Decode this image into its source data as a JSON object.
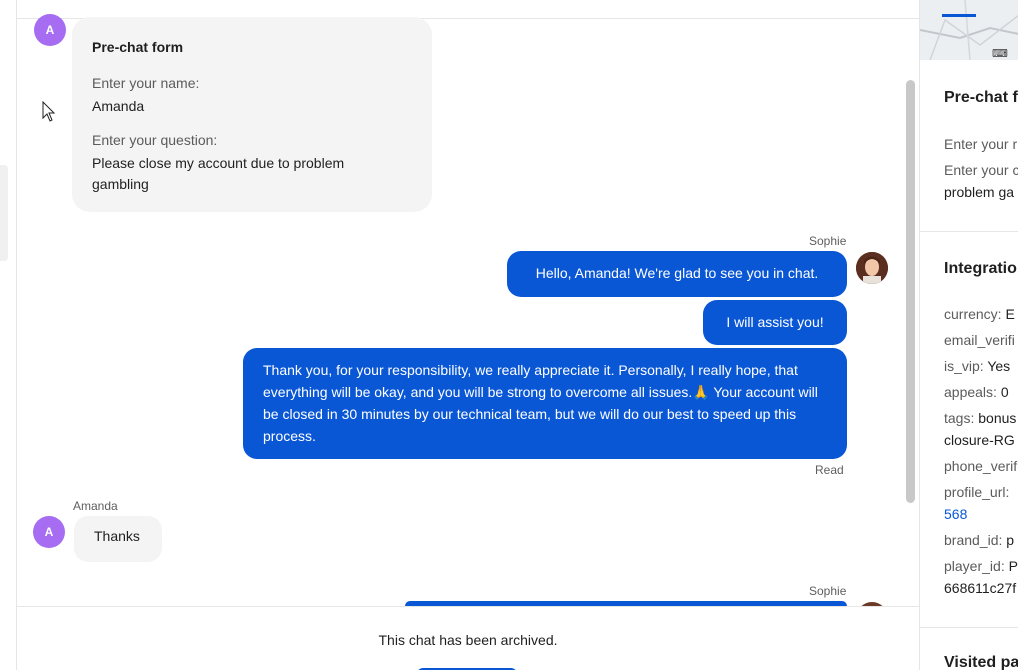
{
  "prechat": {
    "avatar_letter": "A",
    "title": "Pre-chat form",
    "name_label": "Enter your name:",
    "name_value": "Amanda",
    "question_label": "Enter your question:",
    "question_value": "Please close my account due to problem gambling"
  },
  "messages": {
    "agent_name": "Sophie",
    "msg1": "Hello, Amanda! We're glad to see you in chat.",
    "msg2": "I will assist you!",
    "msg3": "Thank you, for your responsibility, we really appreciate it. Personally, I really hope, that everything will be okay, and you will be strong to overcome all issues.🙏 Your account will be closed in 30 minutes by our technical team, but we will do our best to speed up this process.",
    "read_status": "Read",
    "customer_name": "Amanda",
    "customer_avatar": "A",
    "reply": "Thanks",
    "agent_name_2": "Sophie"
  },
  "footer": {
    "archived_text": "This chat has been archived."
  },
  "right_panel": {
    "prechat_title": "Pre-chat f",
    "prechat_line1": "Enter your r",
    "prechat_line2": "Enter your c",
    "prechat_line3": "problem ga",
    "integration_title": "Integratio",
    "fields": [
      {
        "key": "currency:",
        "value": "E"
      },
      {
        "key": "email_verifi",
        "value": ""
      },
      {
        "key": "is_vip:",
        "value": "Yes"
      },
      {
        "key": "appeals:",
        "value": "0"
      },
      {
        "key": "tags:",
        "value": "bonus"
      },
      {
        "key": "",
        "value": "closure-RG"
      },
      {
        "key": "phone_verif",
        "value": ""
      },
      {
        "key": "profile_url:",
        "value": ""
      },
      {
        "key": "",
        "value": "568"
      },
      {
        "key": "brand_id:",
        "value": "p"
      },
      {
        "key": "player_id:",
        "value": "P"
      },
      {
        "key": "",
        "value": "668611c27f"
      }
    ],
    "visited_title": "Visited pa"
  },
  "colors": {
    "accent": "#0a57d6",
    "avatar": "#a66cf2"
  },
  "icons": {
    "cursor": "mouse-pointer",
    "keyboard": "keyboard-icon"
  }
}
